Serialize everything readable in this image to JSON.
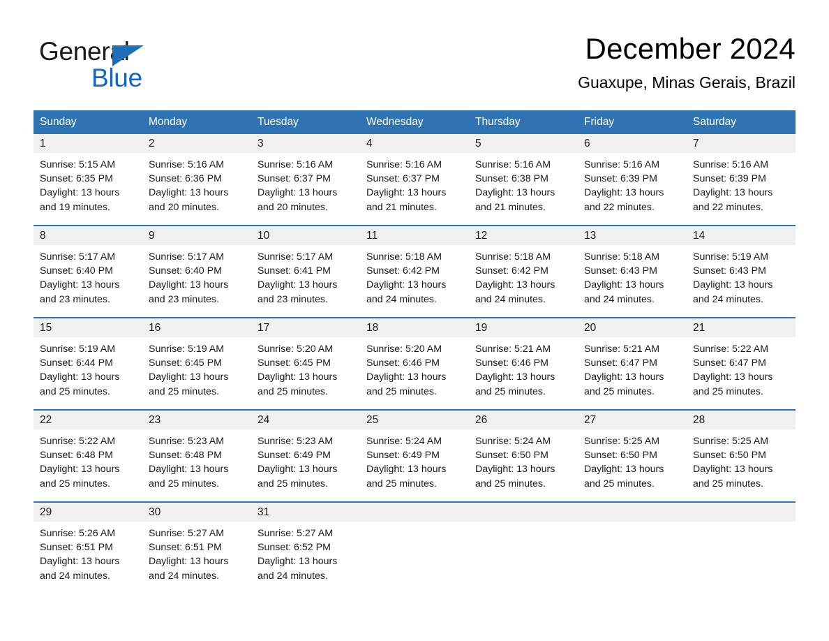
{
  "brand": {
    "name_part1": "General",
    "name_part2": "Blue",
    "triangle_color": "#1f6fb8",
    "blue_text_color": "#1565c0"
  },
  "header": {
    "title": "December 2024",
    "subtitle": "Guaxupe, Minas Gerais, Brazil"
  },
  "theme": {
    "header_blue": "#2f73b3",
    "daynum_background": "#f0f0f0",
    "page_background": "#ffffff",
    "text_color": "#1a1a1a"
  },
  "calendar": {
    "weekday_headers": [
      "Sunday",
      "Monday",
      "Tuesday",
      "Wednesday",
      "Thursday",
      "Friday",
      "Saturday"
    ],
    "weeks": [
      [
        {
          "day": "1",
          "sunrise": "Sunrise: 5:15 AM",
          "sunset": "Sunset: 6:35 PM",
          "daylight_line1": "Daylight: 13 hours",
          "daylight_line2": "and 19 minutes."
        },
        {
          "day": "2",
          "sunrise": "Sunrise: 5:16 AM",
          "sunset": "Sunset: 6:36 PM",
          "daylight_line1": "Daylight: 13 hours",
          "daylight_line2": "and 20 minutes."
        },
        {
          "day": "3",
          "sunrise": "Sunrise: 5:16 AM",
          "sunset": "Sunset: 6:37 PM",
          "daylight_line1": "Daylight: 13 hours",
          "daylight_line2": "and 20 minutes."
        },
        {
          "day": "4",
          "sunrise": "Sunrise: 5:16 AM",
          "sunset": "Sunset: 6:37 PM",
          "daylight_line1": "Daylight: 13 hours",
          "daylight_line2": "and 21 minutes."
        },
        {
          "day": "5",
          "sunrise": "Sunrise: 5:16 AM",
          "sunset": "Sunset: 6:38 PM",
          "daylight_line1": "Daylight: 13 hours",
          "daylight_line2": "and 21 minutes."
        },
        {
          "day": "6",
          "sunrise": "Sunrise: 5:16 AM",
          "sunset": "Sunset: 6:39 PM",
          "daylight_line1": "Daylight: 13 hours",
          "daylight_line2": "and 22 minutes."
        },
        {
          "day": "7",
          "sunrise": "Sunrise: 5:16 AM",
          "sunset": "Sunset: 6:39 PM",
          "daylight_line1": "Daylight: 13 hours",
          "daylight_line2": "and 22 minutes."
        }
      ],
      [
        {
          "day": "8",
          "sunrise": "Sunrise: 5:17 AM",
          "sunset": "Sunset: 6:40 PM",
          "daylight_line1": "Daylight: 13 hours",
          "daylight_line2": "and 23 minutes."
        },
        {
          "day": "9",
          "sunrise": "Sunrise: 5:17 AM",
          "sunset": "Sunset: 6:40 PM",
          "daylight_line1": "Daylight: 13 hours",
          "daylight_line2": "and 23 minutes."
        },
        {
          "day": "10",
          "sunrise": "Sunrise: 5:17 AM",
          "sunset": "Sunset: 6:41 PM",
          "daylight_line1": "Daylight: 13 hours",
          "daylight_line2": "and 23 minutes."
        },
        {
          "day": "11",
          "sunrise": "Sunrise: 5:18 AM",
          "sunset": "Sunset: 6:42 PM",
          "daylight_line1": "Daylight: 13 hours",
          "daylight_line2": "and 24 minutes."
        },
        {
          "day": "12",
          "sunrise": "Sunrise: 5:18 AM",
          "sunset": "Sunset: 6:42 PM",
          "daylight_line1": "Daylight: 13 hours",
          "daylight_line2": "and 24 minutes."
        },
        {
          "day": "13",
          "sunrise": "Sunrise: 5:18 AM",
          "sunset": "Sunset: 6:43 PM",
          "daylight_line1": "Daylight: 13 hours",
          "daylight_line2": "and 24 minutes."
        },
        {
          "day": "14",
          "sunrise": "Sunrise: 5:19 AM",
          "sunset": "Sunset: 6:43 PM",
          "daylight_line1": "Daylight: 13 hours",
          "daylight_line2": "and 24 minutes."
        }
      ],
      [
        {
          "day": "15",
          "sunrise": "Sunrise: 5:19 AM",
          "sunset": "Sunset: 6:44 PM",
          "daylight_line1": "Daylight: 13 hours",
          "daylight_line2": "and 25 minutes."
        },
        {
          "day": "16",
          "sunrise": "Sunrise: 5:19 AM",
          "sunset": "Sunset: 6:45 PM",
          "daylight_line1": "Daylight: 13 hours",
          "daylight_line2": "and 25 minutes."
        },
        {
          "day": "17",
          "sunrise": "Sunrise: 5:20 AM",
          "sunset": "Sunset: 6:45 PM",
          "daylight_line1": "Daylight: 13 hours",
          "daylight_line2": "and 25 minutes."
        },
        {
          "day": "18",
          "sunrise": "Sunrise: 5:20 AM",
          "sunset": "Sunset: 6:46 PM",
          "daylight_line1": "Daylight: 13 hours",
          "daylight_line2": "and 25 minutes."
        },
        {
          "day": "19",
          "sunrise": "Sunrise: 5:21 AM",
          "sunset": "Sunset: 6:46 PM",
          "daylight_line1": "Daylight: 13 hours",
          "daylight_line2": "and 25 minutes."
        },
        {
          "day": "20",
          "sunrise": "Sunrise: 5:21 AM",
          "sunset": "Sunset: 6:47 PM",
          "daylight_line1": "Daylight: 13 hours",
          "daylight_line2": "and 25 minutes."
        },
        {
          "day": "21",
          "sunrise": "Sunrise: 5:22 AM",
          "sunset": "Sunset: 6:47 PM",
          "daylight_line1": "Daylight: 13 hours",
          "daylight_line2": "and 25 minutes."
        }
      ],
      [
        {
          "day": "22",
          "sunrise": "Sunrise: 5:22 AM",
          "sunset": "Sunset: 6:48 PM",
          "daylight_line1": "Daylight: 13 hours",
          "daylight_line2": "and 25 minutes."
        },
        {
          "day": "23",
          "sunrise": "Sunrise: 5:23 AM",
          "sunset": "Sunset: 6:48 PM",
          "daylight_line1": "Daylight: 13 hours",
          "daylight_line2": "and 25 minutes."
        },
        {
          "day": "24",
          "sunrise": "Sunrise: 5:23 AM",
          "sunset": "Sunset: 6:49 PM",
          "daylight_line1": "Daylight: 13 hours",
          "daylight_line2": "and 25 minutes."
        },
        {
          "day": "25",
          "sunrise": "Sunrise: 5:24 AM",
          "sunset": "Sunset: 6:49 PM",
          "daylight_line1": "Daylight: 13 hours",
          "daylight_line2": "and 25 minutes."
        },
        {
          "day": "26",
          "sunrise": "Sunrise: 5:24 AM",
          "sunset": "Sunset: 6:50 PM",
          "daylight_line1": "Daylight: 13 hours",
          "daylight_line2": "and 25 minutes."
        },
        {
          "day": "27",
          "sunrise": "Sunrise: 5:25 AM",
          "sunset": "Sunset: 6:50 PM",
          "daylight_line1": "Daylight: 13 hours",
          "daylight_line2": "and 25 minutes."
        },
        {
          "day": "28",
          "sunrise": "Sunrise: 5:25 AM",
          "sunset": "Sunset: 6:50 PM",
          "daylight_line1": "Daylight: 13 hours",
          "daylight_line2": "and 25 minutes."
        }
      ],
      [
        {
          "day": "29",
          "sunrise": "Sunrise: 5:26 AM",
          "sunset": "Sunset: 6:51 PM",
          "daylight_line1": "Daylight: 13 hours",
          "daylight_line2": "and 24 minutes."
        },
        {
          "day": "30",
          "sunrise": "Sunrise: 5:27 AM",
          "sunset": "Sunset: 6:51 PM",
          "daylight_line1": "Daylight: 13 hours",
          "daylight_line2": "and 24 minutes."
        },
        {
          "day": "31",
          "sunrise": "Sunrise: 5:27 AM",
          "sunset": "Sunset: 6:52 PM",
          "daylight_line1": "Daylight: 13 hours",
          "daylight_line2": "and 24 minutes."
        },
        {
          "day": "",
          "sunrise": "",
          "sunset": "",
          "daylight_line1": "",
          "daylight_line2": ""
        },
        {
          "day": "",
          "sunrise": "",
          "sunset": "",
          "daylight_line1": "",
          "daylight_line2": ""
        },
        {
          "day": "",
          "sunrise": "",
          "sunset": "",
          "daylight_line1": "",
          "daylight_line2": ""
        },
        {
          "day": "",
          "sunrise": "",
          "sunset": "",
          "daylight_line1": "",
          "daylight_line2": ""
        }
      ]
    ]
  }
}
